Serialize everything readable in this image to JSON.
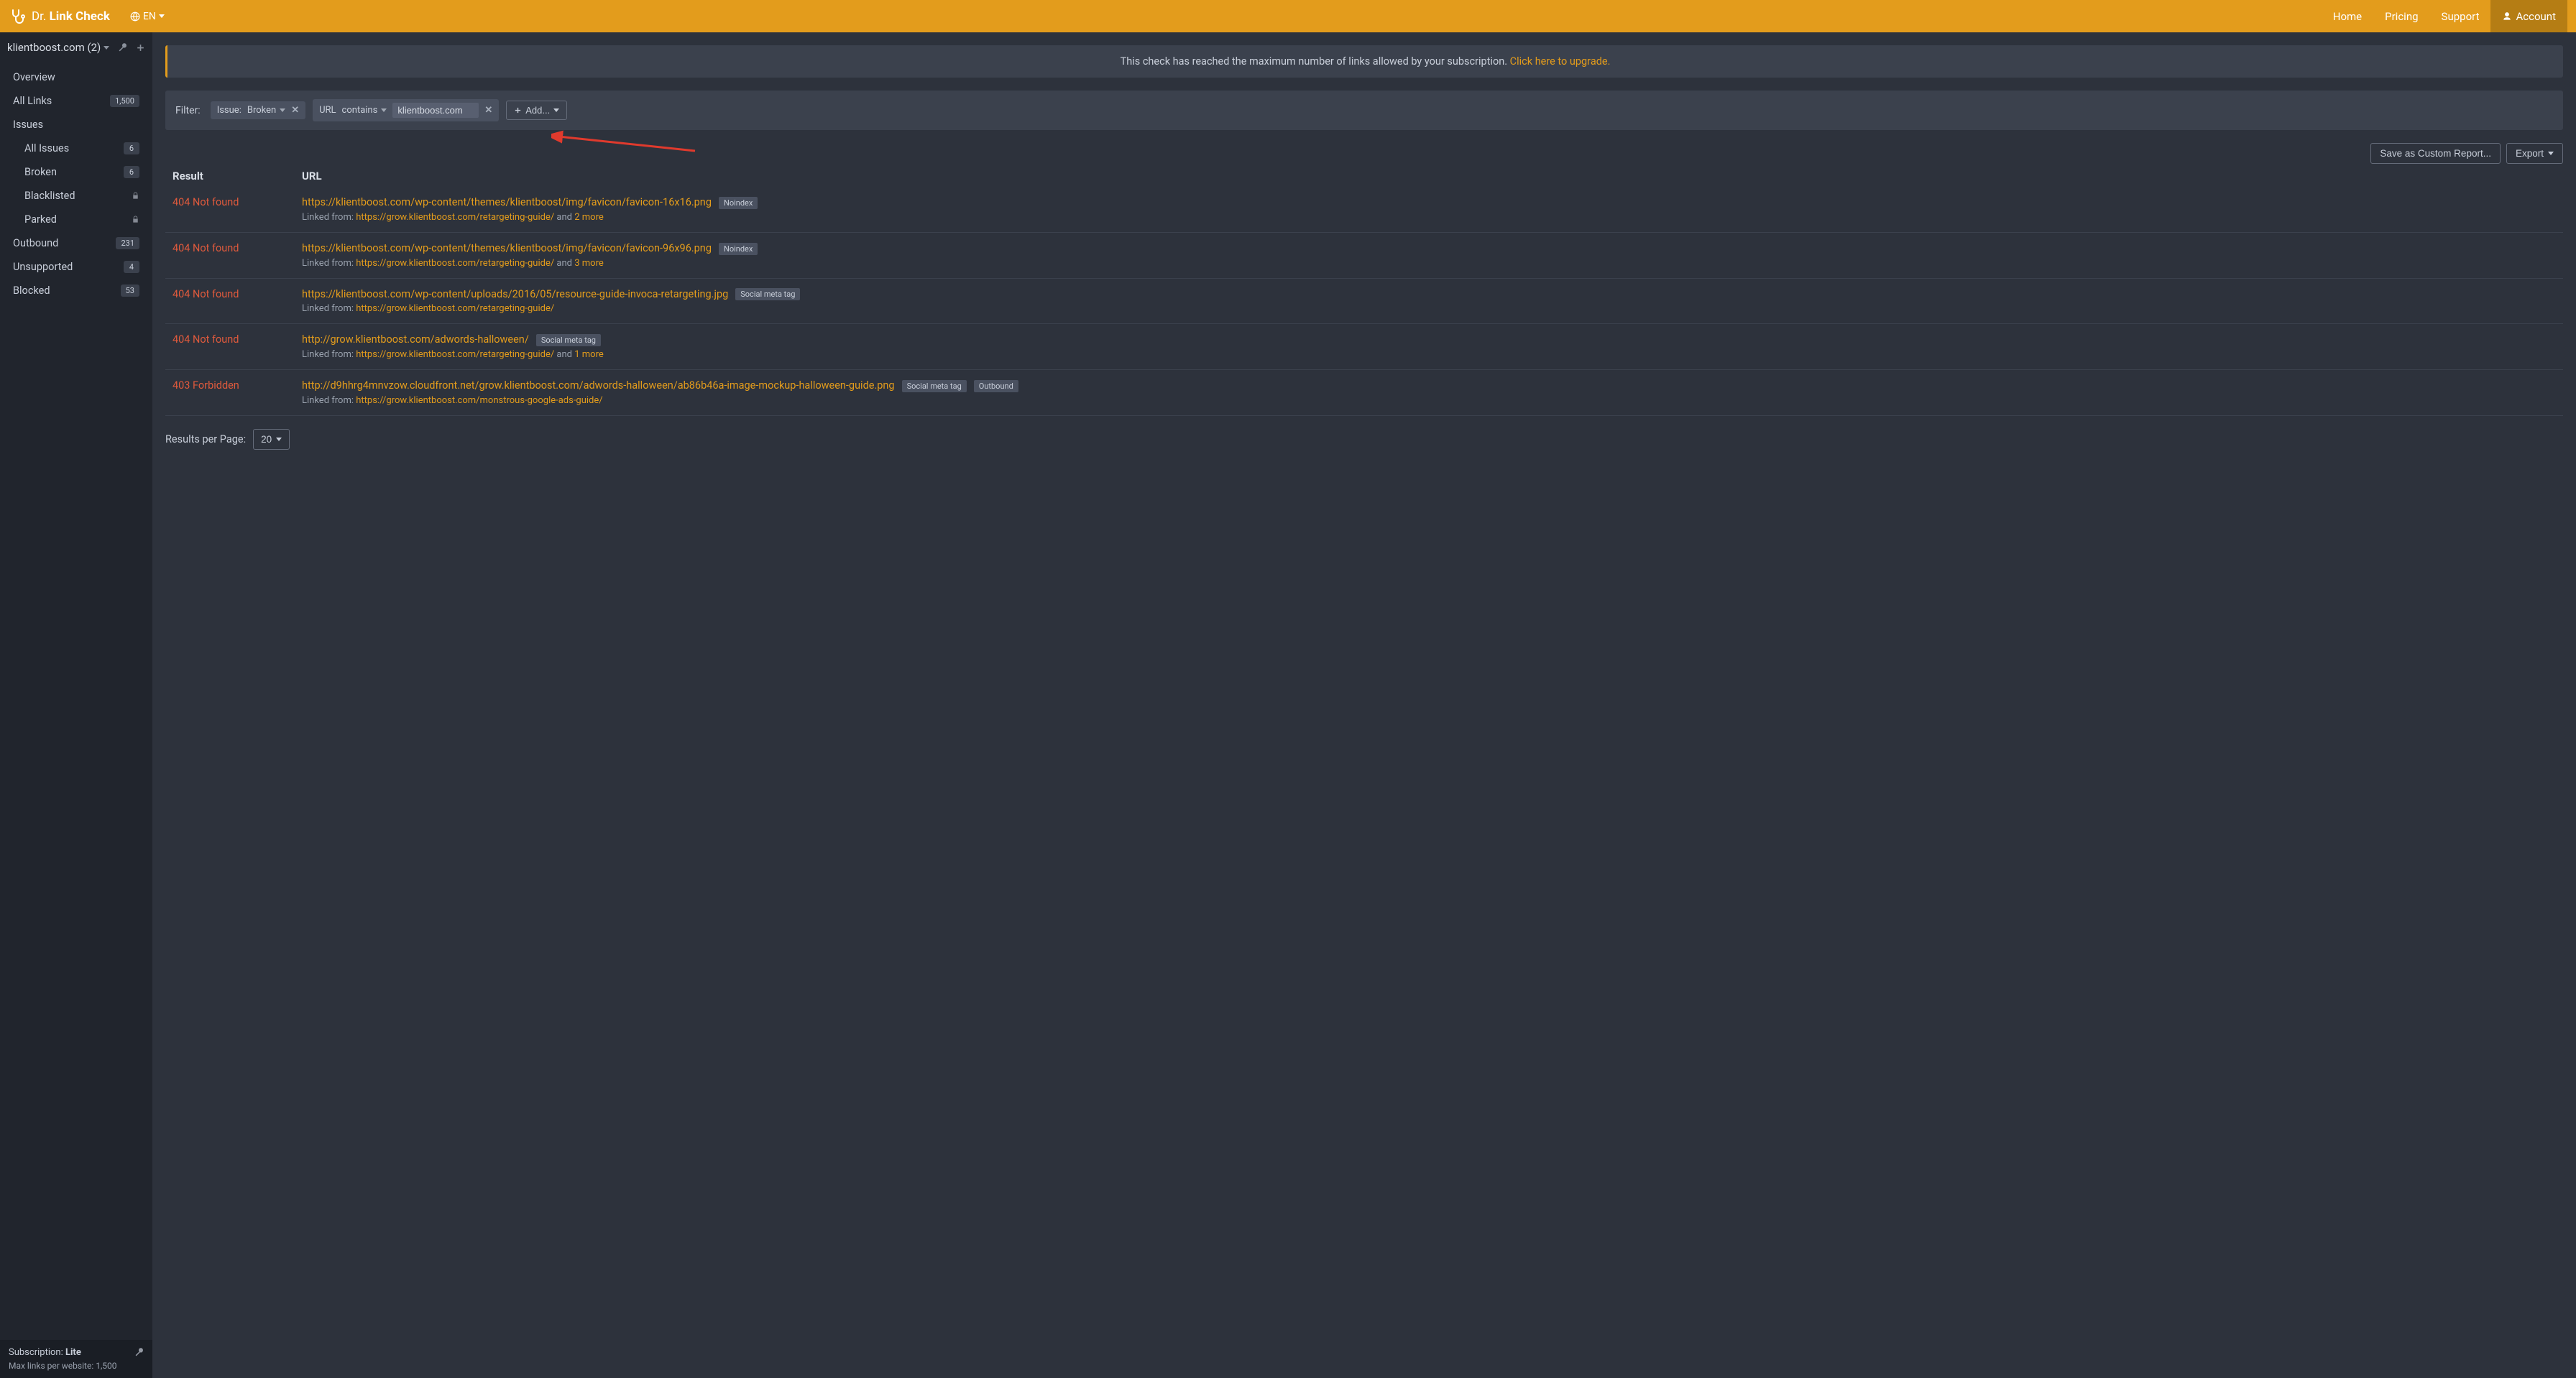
{
  "topbar": {
    "logo_prefix": "Dr.",
    "logo_name": "Link Check",
    "lang_label": "EN",
    "home": "Home",
    "pricing": "Pricing",
    "support": "Support",
    "account": "Account"
  },
  "sidebar": {
    "site_label": "klientboost.com (2)",
    "items": [
      {
        "label": "Overview",
        "badge": "",
        "type": "item"
      },
      {
        "label": "All Links",
        "badge": "1,500",
        "type": "item"
      },
      {
        "label": "Issues",
        "badge": "",
        "type": "item"
      },
      {
        "label": "All Issues",
        "badge": "6",
        "type": "sub"
      },
      {
        "label": "Broken",
        "badge": "6",
        "type": "sub"
      },
      {
        "label": "Blacklisted",
        "badge": "",
        "type": "sub",
        "locked": true
      },
      {
        "label": "Parked",
        "badge": "",
        "type": "sub",
        "locked": true
      },
      {
        "label": "Outbound",
        "badge": "231",
        "type": "item"
      },
      {
        "label": "Unsupported",
        "badge": "4",
        "type": "item"
      },
      {
        "label": "Blocked",
        "badge": "53",
        "type": "item"
      }
    ],
    "subscription_label": "Subscription: ",
    "subscription_level": "Lite",
    "subscription_note": "Max links per website: 1,500"
  },
  "banner": {
    "text": "This check has reached the maximum number of links allowed by your subscription. ",
    "link_text": "Click here to upgrade."
  },
  "filter": {
    "label": "Filter:",
    "chip1_key": "Issue:",
    "chip1_val": "Broken",
    "chip2_key": "URL",
    "chip2_op": "contains",
    "chip2_input": "klientboost.com",
    "add_label": "Add..."
  },
  "toolbar": {
    "save_report": "Save as Custom Report...",
    "export": "Export"
  },
  "table": {
    "header_result": "Result",
    "header_url": "URL",
    "linked_from_label": "Linked from: ",
    "and": "and",
    "rows": [
      {
        "status": "404 Not found",
        "url": "https://klientboost.com/wp-content/themes/klientboost/img/favicon/favicon-16x16.png",
        "tags": [
          "Noindex"
        ],
        "linked_from": "https://grow.klientboost.com/retargeting-guide/",
        "more": "2 more"
      },
      {
        "status": "404 Not found",
        "url": "https://klientboost.com/wp-content/themes/klientboost/img/favicon/favicon-96x96.png",
        "tags": [
          "Noindex"
        ],
        "linked_from": "https://grow.klientboost.com/retargeting-guide/",
        "more": "3 more"
      },
      {
        "status": "404 Not found",
        "url": "https://klientboost.com/wp-content/uploads/2016/05/resource-guide-invoca-retargeting.jpg",
        "tags": [
          "Social meta tag"
        ],
        "linked_from": "https://grow.klientboost.com/retargeting-guide/",
        "more": ""
      },
      {
        "status": "404 Not found",
        "url": "http://grow.klientboost.com/adwords-halloween/",
        "tags": [
          "Social meta tag"
        ],
        "linked_from": "https://grow.klientboost.com/retargeting-guide/",
        "more": "1 more"
      },
      {
        "status": "403 Forbidden",
        "url": "http://d9hhrg4mnvzow.cloudfront.net/grow.klientboost.com/adwords-halloween/ab86b46a-image-mockup-halloween-guide.png",
        "tags": [
          "Social meta tag",
          "Outbound"
        ],
        "linked_from": "https://grow.klientboost.com/monstrous-google-ads-guide/",
        "more": ""
      }
    ]
  },
  "pager": {
    "label": "Results per Page:",
    "value": "20"
  }
}
